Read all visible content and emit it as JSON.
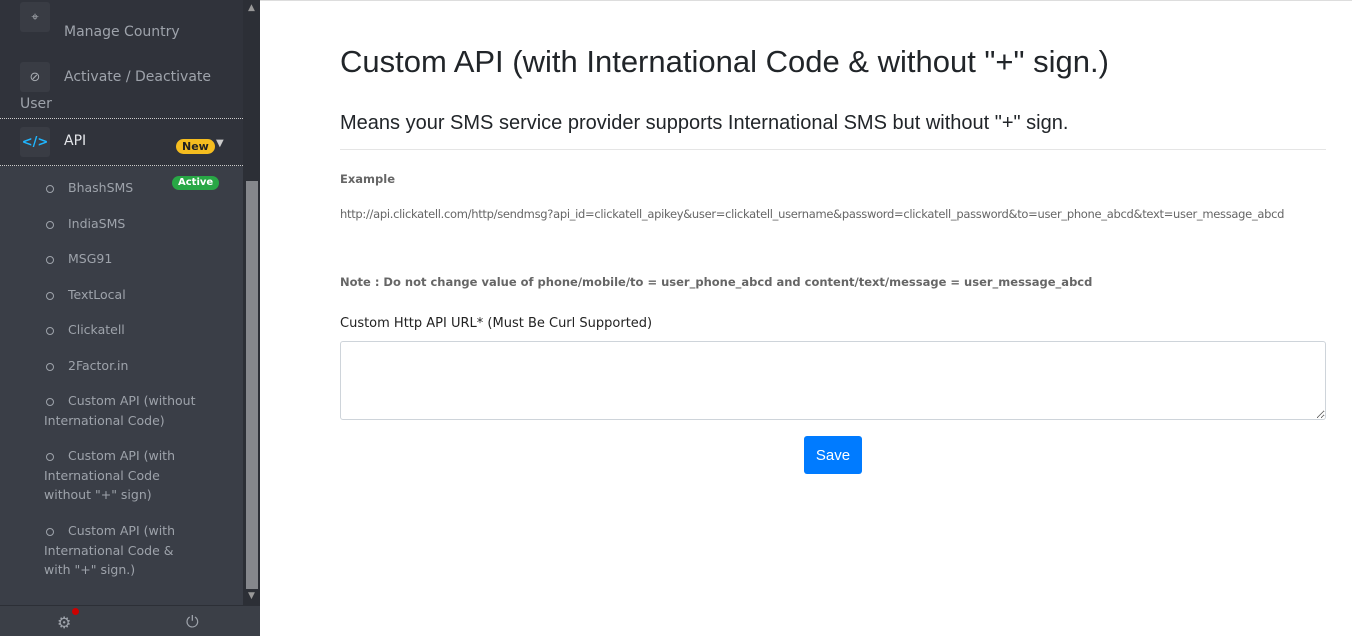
{
  "sidebar": {
    "manage_country": "Manage Country",
    "activate_line1": "Activate / Deactivate",
    "activate_line2": "User",
    "api": "API",
    "api_badge": "New",
    "submenu": [
      "BhashSMS",
      "IndiaSMS",
      "MSG91",
      "TextLocal",
      "Clickatell",
      "2Factor.in",
      "Custom API (without International Code)",
      "Custom API (with International Code without \"+\" sign)",
      "Custom API (with International Code & with \"+\" sign.)"
    ],
    "active_badge": "Active"
  },
  "main": {
    "title": "Custom API (with International Code & without \"+\" sign.)",
    "subtitle": "Means your SMS service provider supports International SMS but without \"+\" sign.",
    "example_label": "Example",
    "example_url": "http://api.clickatell.com/http/sendmsg?api_id=clickatell_apikey&user=clickatell_username&password=clickatell_password&to=user_phone_abcd&text=user_message_abcd",
    "note": "Note : Do not change value of phone/mobile/to = user_phone_abcd and content/text/message = user_message_abcd",
    "field_label": "Custom Http API URL* (Must Be Curl Supported)",
    "field_value": "",
    "save": "Save"
  }
}
